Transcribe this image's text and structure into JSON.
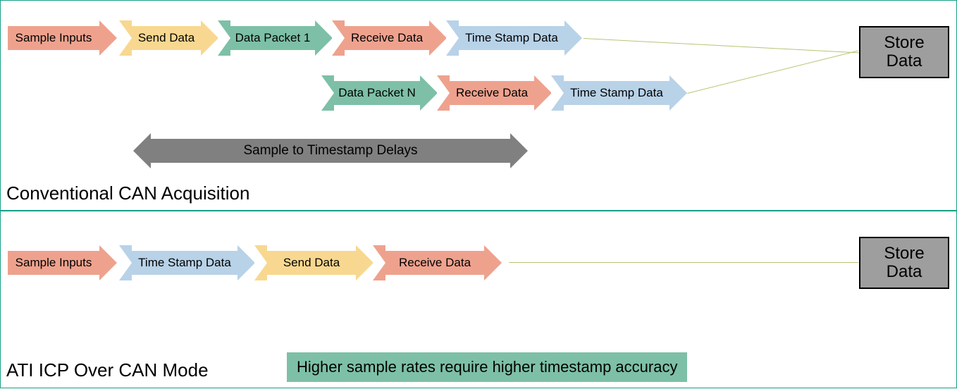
{
  "top": {
    "row1": {
      "sample_inputs": "Sample Inputs",
      "send_data": "Send Data",
      "data_packet_1": "Data Packet 1",
      "receive_data": "Receive Data",
      "time_stamp": "Time Stamp Data"
    },
    "row2": {
      "data_packet_n": "Data Packet N",
      "receive_data": "Receive Data",
      "time_stamp": "Time Stamp Data"
    },
    "store": "Store\nData",
    "delay_label": "Sample to Timestamp Delays",
    "caption": "Conventional CAN Acquisition"
  },
  "bottom": {
    "row": {
      "sample_inputs": "Sample Inputs",
      "time_stamp": "Time Stamp Data",
      "send_data": "Send Data",
      "receive_data": "Receive Data"
    },
    "store": "Store\nData",
    "caption": "ATI ICP Over CAN Mode",
    "note": "Higher sample rates require higher timestamp accuracy"
  },
  "colors": {
    "salmon": "#eea28e",
    "yellow": "#f8d890",
    "teal": "#7dc0a7",
    "blue": "#b8d2e8",
    "gray": "#808080",
    "border": "#16a085"
  }
}
